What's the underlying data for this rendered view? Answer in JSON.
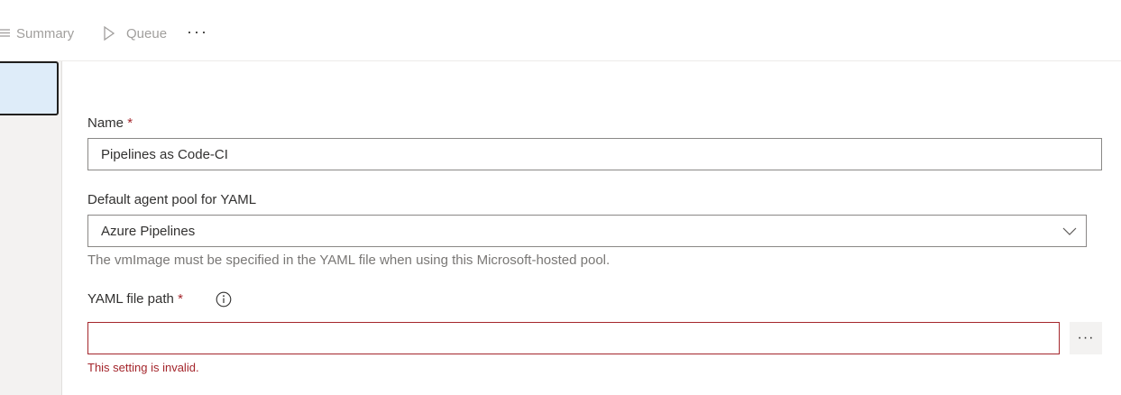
{
  "toolbar": {
    "summary_label": "Summary",
    "queue_label": "Queue",
    "more_label": "···"
  },
  "form": {
    "name": {
      "label": "Name",
      "required_mark": "*",
      "value": "Pipelines as Code-CI"
    },
    "agent_pool": {
      "label": "Default agent pool for YAML",
      "value": "Azure Pipelines",
      "helper": "The vmImage must be specified in the YAML file when using this Microsoft-hosted pool."
    },
    "yaml_path": {
      "label": "YAML file path",
      "required_mark": "*",
      "value": "",
      "error": "This setting is invalid.",
      "browse_label": "···"
    }
  },
  "colors": {
    "accent_selected": "#deecf9",
    "error": "#a4262c",
    "disabled_text": "#a19f9d"
  },
  "icons": [
    "list-icon",
    "play-icon",
    "info-icon",
    "chevron-down-icon"
  ]
}
